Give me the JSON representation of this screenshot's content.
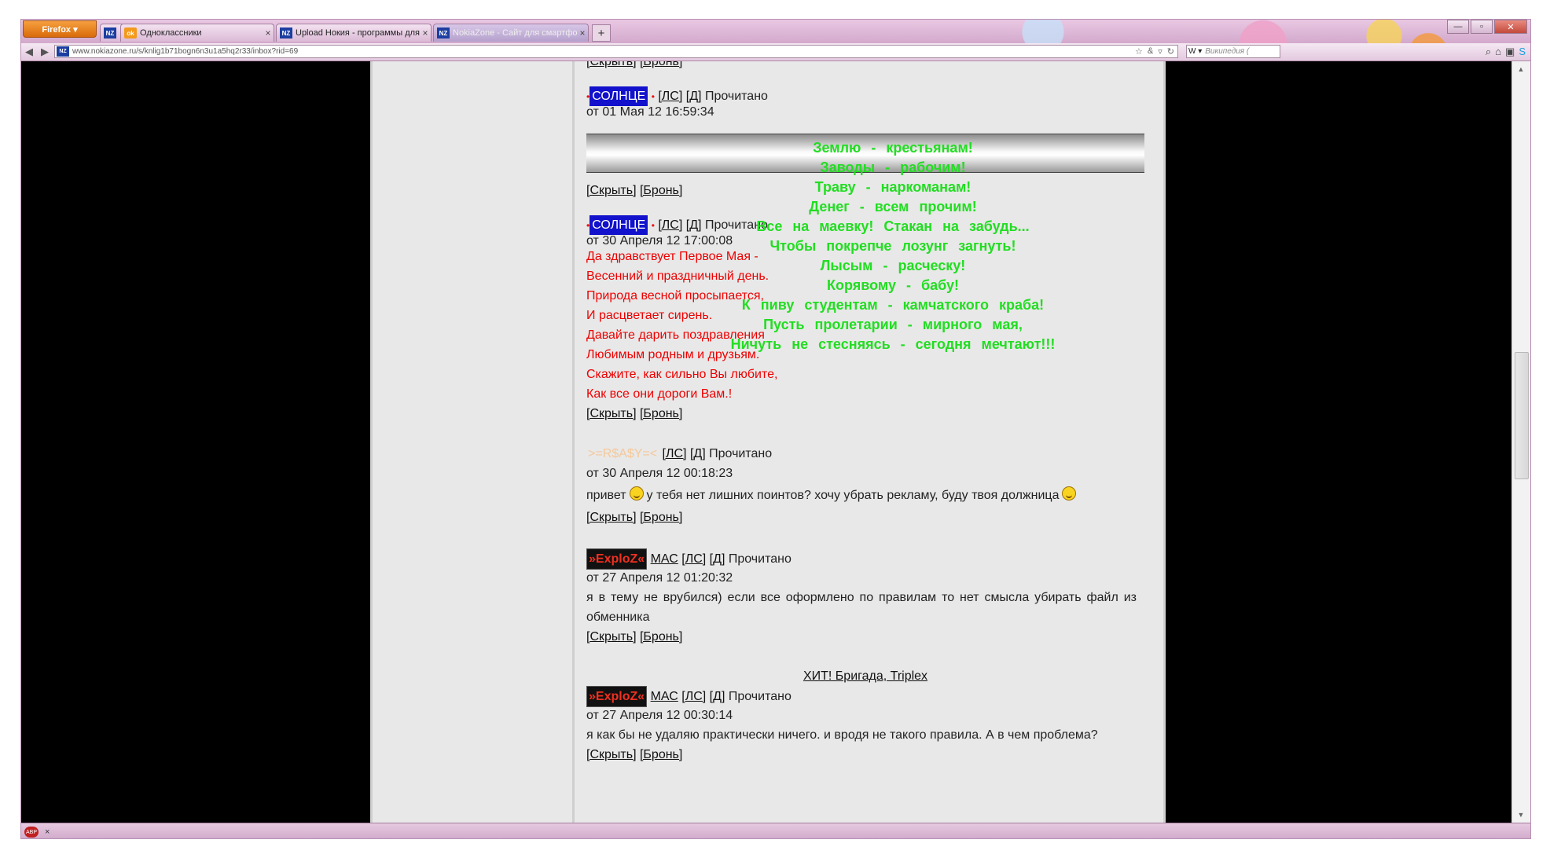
{
  "browser": {
    "menu_button": "Firefox ▾",
    "tabs": [
      {
        "icon": "NZ",
        "label": "",
        "close": ""
      },
      {
        "icon": "ok",
        "label": "Одноклассники",
        "close": "×"
      },
      {
        "icon": "NZ",
        "label": "Upload Нокия - программы для см...",
        "close": "×"
      },
      {
        "icon": "NZ",
        "label": "NokiaZone - Сайт для смартфонов ...",
        "close": "×"
      }
    ],
    "new_tab": "+",
    "url": "www.nokiazone.ru/s/knlig1b71bogn6n3u1a5hq2r33/inbox?rid=69",
    "search_placeholder": "Википедия (",
    "search_engine": "W ▾",
    "window_controls": {
      "minimize": "—",
      "maximize": "▫",
      "close": "✕"
    }
  },
  "page": {
    "top_links": {
      "hide": "[Скрыть]",
      "ban": "[Бронь]"
    },
    "messages": [
      {
        "nick": "СОЛНЦЕ",
        "ls": "[ЛС]",
        "d": "[Д]",
        "status": "Прочитано",
        "date": "от 01 Мая 12 16:59:34",
        "hide": "[Скрыть]",
        "ban": "[Бронь]"
      },
      {
        "nick": "СОЛНЦЕ",
        "ls": "[ЛС]",
        "d": "[Д]",
        "status": "Прочитано",
        "date": "от 30 Апреля 12 17:00:08",
        "lines": [
          "Да здравствует Первое Мая -",
          "Весенний и праздничный день.",
          "Природа весной просыпается,",
          "И расцветает сирень.",
          "Давайте дарить поздравления",
          "Любимым родным и друзьям.",
          "Скажите, как сильно Вы любите,",
          "Как все они дороги Вам.!"
        ],
        "hide": "[Скрыть]",
        "ban": "[Бронь]"
      },
      {
        "nick": ">=R$A$Y=<",
        "ls": "[ЛС]",
        "d": "[Д]",
        "status": "Прочитано",
        "date": "от 30 Апреля 12 00:18:23",
        "text_a": "привет",
        "text_b": "у тебя нет лишних поинтов? хочу убрать рекламу, буду твоя должница",
        "hide": "[Скрыть]",
        "ban": "[Бронь]"
      },
      {
        "nick": "»ExploZ«",
        "user": "МАС",
        "ls": "[ЛС]",
        "d": "[Д]",
        "status": "Прочитано",
        "date": "от 27 Апреля 12 01:20:32",
        "text": "я в тему не врубился) если все оформлено по правилам то нет смысла убирать файл из обменника",
        "hide": "[Скрыть]",
        "ban": "[Бронь]"
      },
      {
        "topic": "ХИТ! Бригада, Triplex",
        "nick": "»ExploZ«",
        "user": "МАС",
        "ls": "[ЛС]",
        "d": "[Д]",
        "status": "Прочитано",
        "date": "от 27 Апреля 12 00:30:14",
        "text": "я как бы не удаляю практически ничего. и вродя не такого правила. А в чем проблема?",
        "hide": "[Скрыть]",
        "ban": "[Бронь]"
      }
    ],
    "poem": [
      "Землю - крестьянам!",
      "Заводы - рабочим!",
      "Траву - наркоманам!",
      "Денег - всем прочим!",
      "Все на маевку! Стакан на забудь...",
      "Чтобы покрепче лозунг загнуть!",
      "Лысым - расческу!",
      "Корявому - бабу!",
      "К пиву студентам - камчатского краба!",
      "Пусть пролетарии - мирного мая,",
      "Ничуть не стесняясь - сегодня мечтают!!!"
    ]
  },
  "statusbar": {
    "addon": "ABP",
    "close": "×"
  },
  "colors": {
    "poem": "#22dd22",
    "red_text": "#e00000",
    "nick_bg": "#1212cc"
  }
}
